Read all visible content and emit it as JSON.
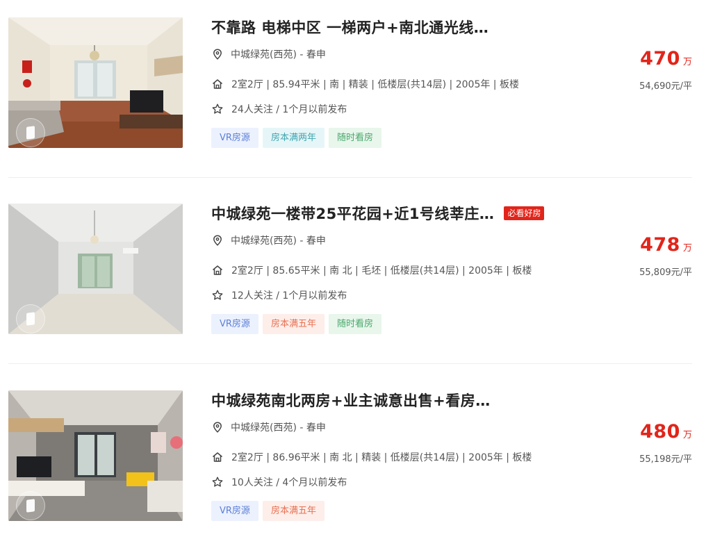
{
  "listings": [
    {
      "title": "不靠路 电梯中区 一梯两户+南北通光线…",
      "badge": "",
      "location": "中城绿苑(西苑) - 春申",
      "attributes": "2室2厅 | 85.94平米 | 南 | 精装 | 低楼层(共14层) | 2005年 | 板楼",
      "follow": "24人关注 / 1个月以前发布",
      "tags": [
        {
          "label": "VR房源",
          "kind": "vr"
        },
        {
          "label": "房本满两年",
          "kind": "two-years"
        },
        {
          "label": "随时看房",
          "kind": "anytime"
        }
      ],
      "price_total": "470",
      "price_unit": "万",
      "price_per": "54,690元/平"
    },
    {
      "title": "中城绿苑一楼带25平花园+近1号线莘庄…",
      "badge": "必看好房",
      "location": "中城绿苑(西苑) - 春申",
      "attributes": "2室2厅 | 85.65平米 | 南 北 | 毛坯 | 低楼层(共14层) | 2005年 | 板楼",
      "follow": "12人关注 / 1个月以前发布",
      "tags": [
        {
          "label": "VR房源",
          "kind": "vr"
        },
        {
          "label": "房本满五年",
          "kind": "five-years"
        },
        {
          "label": "随时看房",
          "kind": "anytime"
        }
      ],
      "price_total": "478",
      "price_unit": "万",
      "price_per": "55,809元/平"
    },
    {
      "title": "中城绿苑南北两房+业主诚意出售+看房…",
      "badge": "",
      "location": "中城绿苑(西苑) - 春申",
      "attributes": "2室2厅 | 86.96平米 | 南 北 | 精装 | 低楼层(共14层) | 2005年 | 板楼",
      "follow": "10人关注 / 4个月以前发布",
      "tags": [
        {
          "label": "VR房源",
          "kind": "vr"
        },
        {
          "label": "房本满五年",
          "kind": "five-years"
        }
      ],
      "price_total": "480",
      "price_unit": "万",
      "price_per": "55,198元/平"
    }
  ],
  "icons": {
    "location": "location-pin-icon",
    "attributes": "house-icon",
    "follow": "star-icon",
    "vr": "vr-360-icon"
  },
  "colors": {
    "price": "#e1251b",
    "must_see_badge": "#e1251b",
    "tag_vr": "#5b7fd6",
    "tag_two_years": "#3fa5b0",
    "tag_five_years": "#e87152",
    "tag_anytime": "#4aa86c"
  }
}
